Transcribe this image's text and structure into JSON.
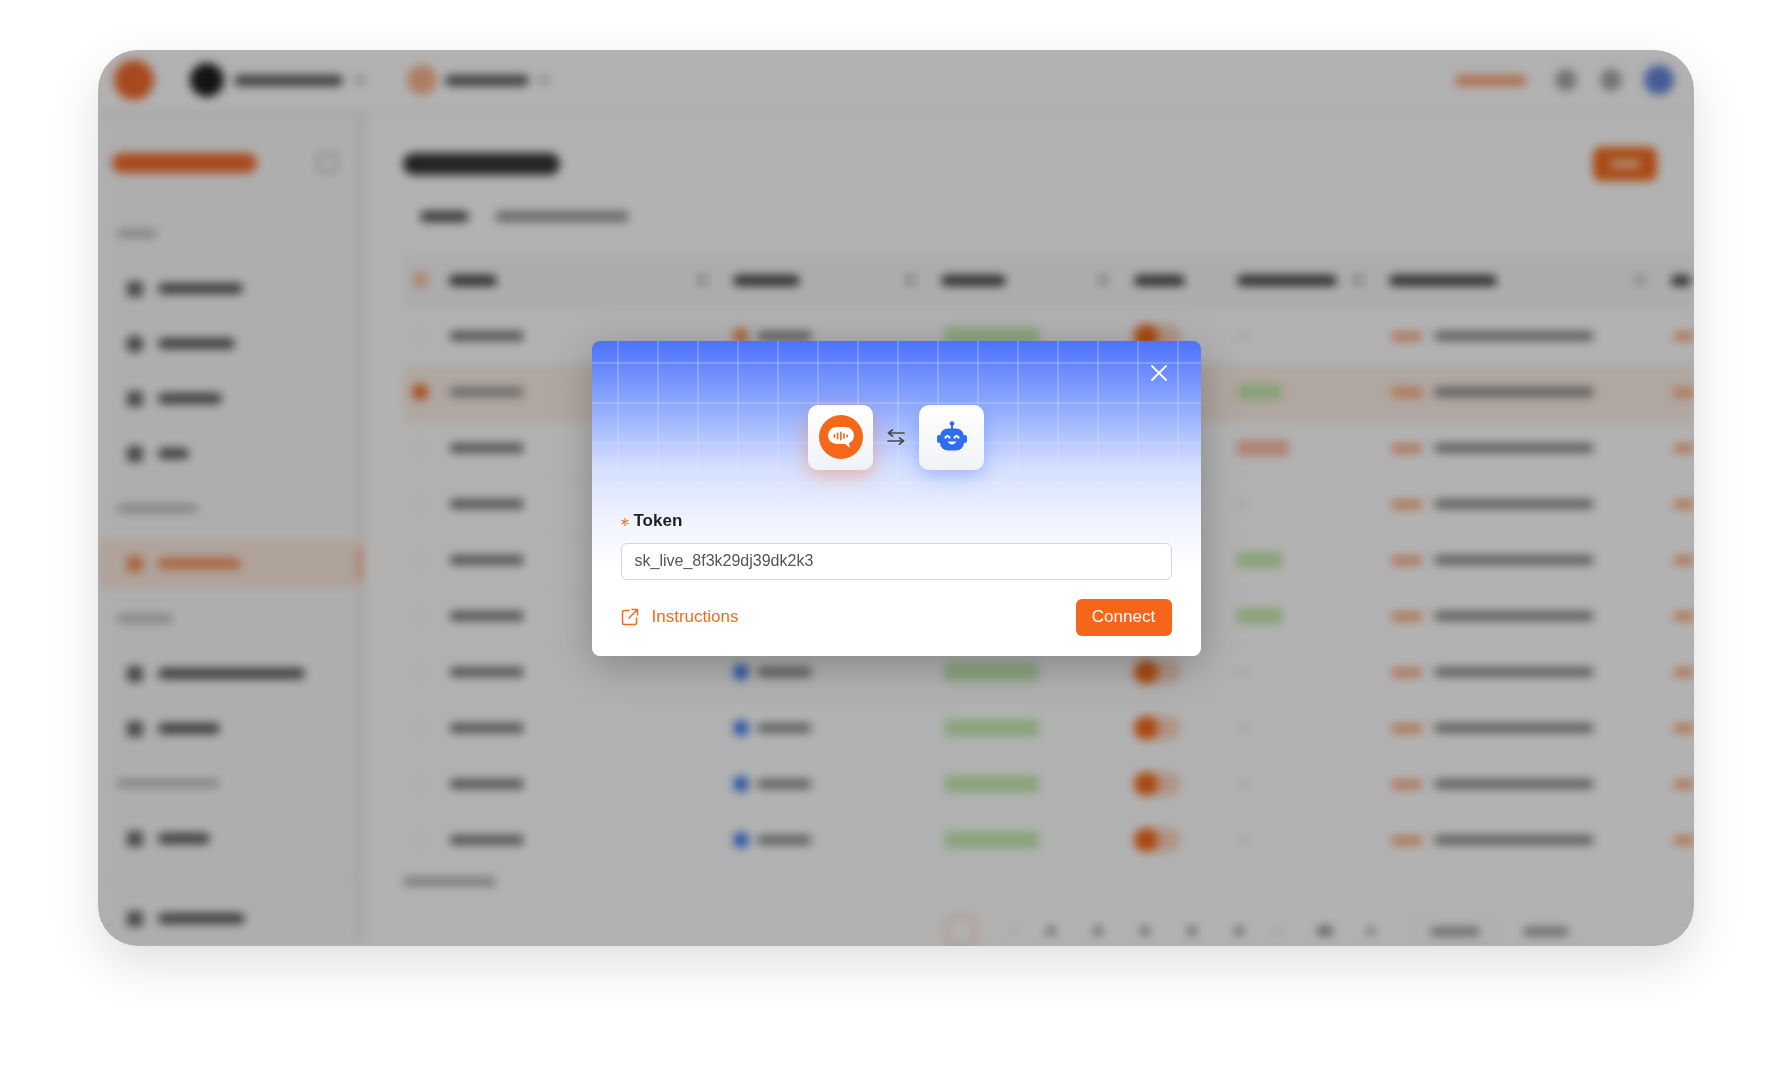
{
  "background_app": {
    "sidebar": {
      "items": [
        {
          "selected": false
        },
        {
          "selected": false
        },
        {
          "selected": false
        },
        {
          "selected": false
        },
        {
          "selected": true
        },
        {
          "selected": false
        },
        {
          "selected": false
        },
        {
          "selected": false
        },
        {
          "selected": false
        }
      ]
    },
    "table": {
      "header_checkbox": {
        "indeterminate": true
      },
      "rows": [
        {
          "selected": false,
          "on": true
        },
        {
          "selected": true
        },
        {
          "selected": false
        },
        {
          "selected": false
        },
        {
          "selected": false
        },
        {
          "selected": false
        },
        {
          "selected": false,
          "on": true
        },
        {
          "selected": false,
          "on": true
        },
        {
          "selected": false,
          "on": true
        },
        {
          "selected": false,
          "on": true
        }
      ]
    }
  },
  "dialog": {
    "token_field": {
      "label": "Token",
      "required": true,
      "value": "sk_live_8f3k29dj39dk2k3"
    },
    "instructions_link": {
      "label": "Instructions"
    },
    "connect_button": {
      "label": "Connect"
    }
  }
}
